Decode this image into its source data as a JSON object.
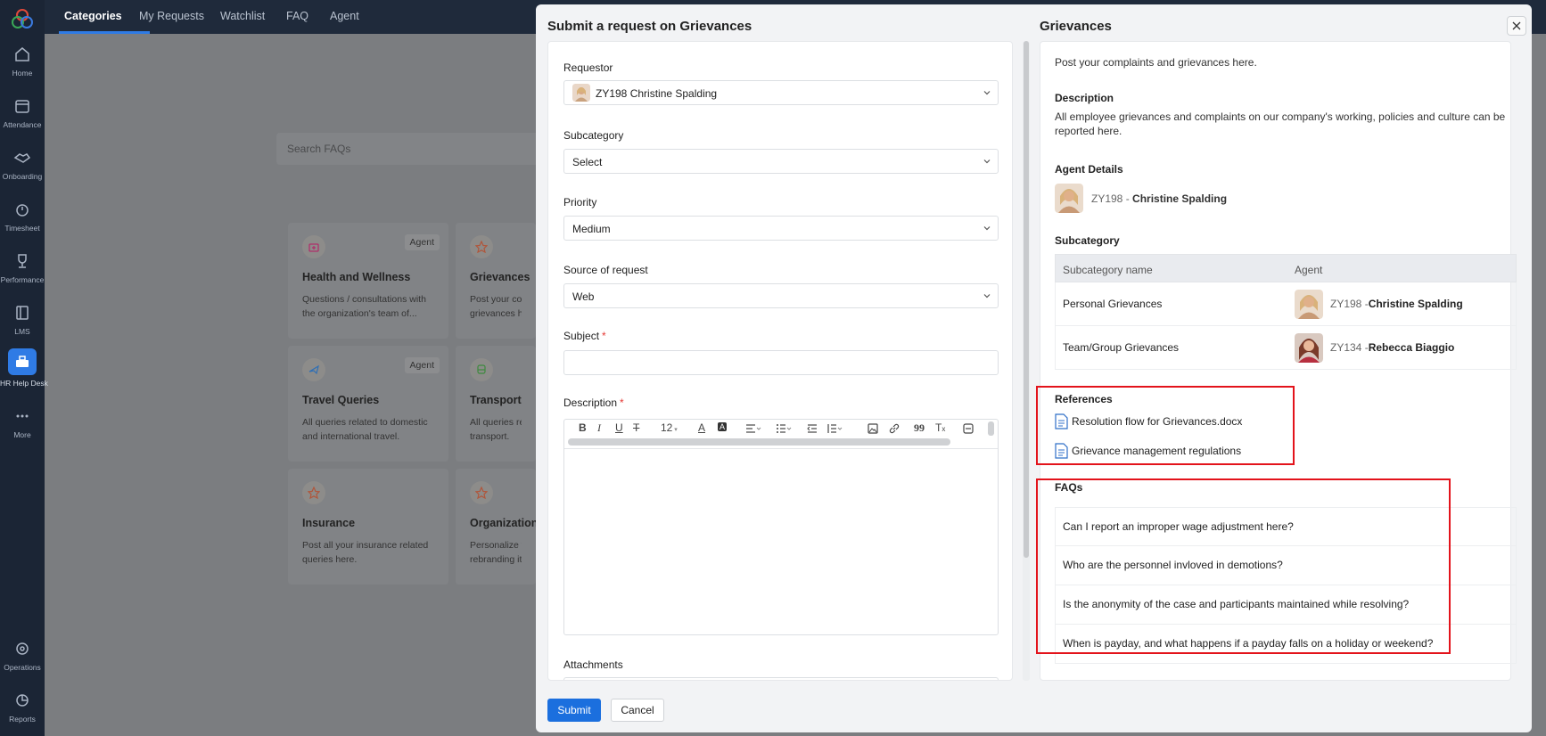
{
  "nav": {
    "items": [
      {
        "label": "Home",
        "icon": "home-icon"
      },
      {
        "label": "Attendance",
        "icon": "calendar-icon"
      },
      {
        "label": "Onboarding",
        "icon": "handshake-icon"
      },
      {
        "label": "Timesheet",
        "icon": "timer-icon"
      },
      {
        "label": "Performance",
        "icon": "trophy-icon"
      },
      {
        "label": "LMS",
        "icon": "book-icon"
      },
      {
        "label": "HR Help Desk",
        "icon": "desk-icon"
      },
      {
        "label": "More",
        "icon": "ellipsis-icon"
      },
      {
        "label": "Operations",
        "icon": "gear-icon"
      },
      {
        "label": "Reports",
        "icon": "pie-chart-icon"
      }
    ]
  },
  "topnav": {
    "tabs": [
      "Categories",
      "My Requests",
      "Watchlist",
      "FAQ",
      "Agent"
    ]
  },
  "background": {
    "search_placeholder": "Search FAQs",
    "cards": [
      {
        "title": "Health and Wellness",
        "desc1": "Questions / consultations with",
        "desc2": "the organization's team of...",
        "badge": "Agent"
      },
      {
        "title": "Grievances",
        "desc1": "Post your compla",
        "desc2": "grievances here."
      },
      {
        "title": "Travel Queries",
        "desc1": "All queries related to domestic",
        "desc2": "and international travel.",
        "badge": "Agent"
      },
      {
        "title": "Transport",
        "desc1": "All queries relate",
        "desc2": "transport."
      },
      {
        "title": "Insurance",
        "desc1": "Post all your insurance related",
        "desc2": "queries here."
      },
      {
        "title": "Organization",
        "desc1": "Personalize your",
        "desc2": "rebranding it. Se"
      }
    ]
  },
  "modal": {
    "form_title": "Submit a request on Grievances",
    "form": {
      "requestor_label": "Requestor",
      "requestor_value": "ZY198 Christine Spalding",
      "subcategory_label": "Subcategory",
      "subcategory_value": "Select",
      "priority_label": "Priority",
      "priority_value": "Medium",
      "source_label": "Source of request",
      "source_value": "Web",
      "subject_label": "Subject",
      "subject_value": "",
      "description_label": "Description",
      "font_size": "12",
      "attachments_label": "Attachments"
    },
    "submit_label": "Submit",
    "cancel_label": "Cancel",
    "info": {
      "title": "Grievances",
      "tagline": "Post your complaints and grievances here.",
      "description_head": "Description",
      "description_text1": "All employee grievances and complaints on our company's working, policies and culture can be",
      "description_text2": "reported here.",
      "agent_head": "Agent Details",
      "agent_id": "ZY198 - ",
      "agent_name": "Christine Spalding",
      "subcategory_head": "Subcategory",
      "table_headers": [
        "Subcategory name",
        "Agent"
      ],
      "rows": [
        {
          "name": "Personal Grievances",
          "agent_id": "ZY198 - ",
          "agent_name": "Christine Spalding"
        },
        {
          "name": "Team/Group Grievances",
          "agent_id": "ZY134 - ",
          "agent_name": "Rebecca Biaggio"
        }
      ],
      "references_head": "References",
      "references": [
        "Resolution flow for Grievances.docx",
        "Grievance management regulations"
      ],
      "faqs_head": "FAQs",
      "faqs": [
        "Can I report an improper wage adjustment here?",
        "Who are the personnel invloved in demotions?",
        "Is the anonymity of the case and participants maintained while resolving?",
        "When is payday, and what happens if a payday falls on a holiday or weekend?"
      ]
    }
  },
  "colors": {
    "accent": "#2f7be5",
    "submit": "#1b6fde",
    "highlight": "#e3131b",
    "nav_bg": "#1b2535"
  }
}
